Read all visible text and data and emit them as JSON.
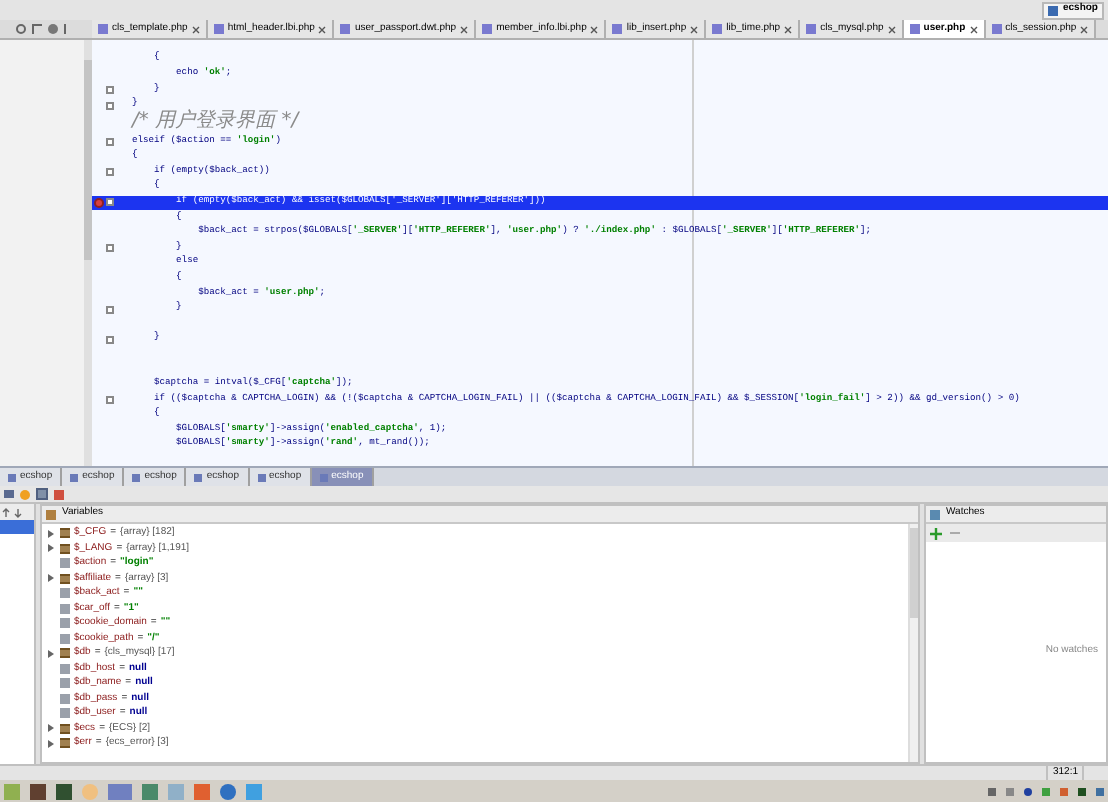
{
  "window_tab": {
    "label": "ecshop"
  },
  "file_tabs": [
    {
      "label": "cls_template.php",
      "selected": false
    },
    {
      "label": "html_header.lbi.php",
      "selected": false
    },
    {
      "label": "user_passport.dwt.php",
      "selected": false
    },
    {
      "label": "member_info.lbi.php",
      "selected": false
    },
    {
      "label": "lib_insert.php",
      "selected": false
    },
    {
      "label": "lib_time.php",
      "selected": false
    },
    {
      "label": "cls_mysql.php",
      "selected": false
    },
    {
      "label": "user.php",
      "selected": true
    },
    {
      "label": "cls_session.php",
      "selected": false
    }
  ],
  "code_lines": [
    {
      "text": "    {",
      "fold": false,
      "current": false,
      "kind": "code"
    },
    {
      "text": "        echo 'ok';",
      "fold": false,
      "current": false,
      "kind": "code"
    },
    {
      "text": "    }",
      "fold": true,
      "current": false,
      "kind": "code"
    },
    {
      "text": "}",
      "fold": true,
      "current": false,
      "kind": "code"
    },
    {
      "text": "/* 用户登录界面 */",
      "fold": false,
      "current": false,
      "kind": "comment"
    },
    {
      "text": "elseif ($action == 'login')",
      "fold": true,
      "current": false,
      "kind": "code"
    },
    {
      "text": "{",
      "fold": false,
      "current": false,
      "kind": "code"
    },
    {
      "text": "    if (empty($back_act))",
      "fold": true,
      "current": false,
      "kind": "code"
    },
    {
      "text": "    {",
      "fold": false,
      "current": false,
      "kind": "code"
    },
    {
      "text": "        if (empty($back_act) && isset($GLOBALS['_SERVER']['HTTP_REFERER']))",
      "fold": true,
      "current": true,
      "kind": "code"
    },
    {
      "text": "        {",
      "fold": false,
      "current": false,
      "kind": "code"
    },
    {
      "text": "            $back_act = strpos($GLOBALS['_SERVER']['HTTP_REFERER'], 'user.php') ? './index.php' : $GLOBALS['_SERVER']['HTTP_REFERER'];",
      "fold": false,
      "current": false,
      "kind": "code"
    },
    {
      "text": "        }",
      "fold": true,
      "current": false,
      "kind": "code"
    },
    {
      "text": "        else",
      "fold": false,
      "current": false,
      "kind": "code"
    },
    {
      "text": "        {",
      "fold": false,
      "current": false,
      "kind": "code"
    },
    {
      "text": "            $back_act = 'user.php';",
      "fold": false,
      "current": false,
      "kind": "code"
    },
    {
      "text": "        }",
      "fold": true,
      "current": false,
      "kind": "code"
    },
    {
      "kind": "blank"
    },
    {
      "text": "    }",
      "fold": true,
      "current": false,
      "kind": "code"
    },
    {
      "kind": "blank"
    },
    {
      "kind": "blank"
    },
    {
      "text": "    $captcha = intval($_CFG['captcha']);",
      "fold": false,
      "current": false,
      "kind": "code"
    },
    {
      "text": "    if (($captcha & CAPTCHA_LOGIN) && (!($captcha & CAPTCHA_LOGIN_FAIL) || (($captcha & CAPTCHA_LOGIN_FAIL) && $_SESSION['login_fail'] > 2)) && gd_version() > 0)",
      "fold": true,
      "current": false,
      "kind": "code"
    },
    {
      "text": "    {",
      "fold": false,
      "current": false,
      "kind": "code"
    },
    {
      "text": "        $GLOBALS['smarty']->assign('enabled_captcha', 1);",
      "fold": false,
      "current": false,
      "kind": "code"
    },
    {
      "text": "        $GLOBALS['smarty']->assign('rand', mt_rand());",
      "fold": false,
      "current": false,
      "kind": "code"
    }
  ],
  "debug_tabs": [
    {
      "label": "ecshop",
      "selected": false
    },
    {
      "label": "ecshop",
      "selected": false
    },
    {
      "label": "ecshop",
      "selected": false
    },
    {
      "label": "ecshop",
      "selected": false
    },
    {
      "label": "ecshop",
      "selected": false
    },
    {
      "label": "ecshop",
      "selected": true
    }
  ],
  "frames": [
    {
      "selected": true
    }
  ],
  "variables": {
    "title": "Variables",
    "items": [
      {
        "name": "$_CFG",
        "operator": "=",
        "value": "{array} [182]",
        "expandable": true,
        "kind": "object"
      },
      {
        "name": "$_LANG",
        "operator": "=",
        "value": "{array} [1,191]",
        "expandable": true,
        "kind": "object"
      },
      {
        "name": "$action",
        "operator": "=",
        "value": "\"login\"",
        "expandable": false,
        "kind": "string"
      },
      {
        "name": "$affiliate",
        "operator": "=",
        "value": "{array} [3]",
        "expandable": true,
        "kind": "object"
      },
      {
        "name": "$back_act",
        "operator": "=",
        "value": "\"\"",
        "expandable": false,
        "kind": "string"
      },
      {
        "name": "$car_off",
        "operator": "=",
        "value": "\"1\"",
        "expandable": false,
        "kind": "string"
      },
      {
        "name": "$cookie_domain",
        "operator": "=",
        "value": "\"\"",
        "expandable": false,
        "kind": "string"
      },
      {
        "name": "$cookie_path",
        "operator": "=",
        "value": "\"/\"",
        "expandable": false,
        "kind": "string"
      },
      {
        "name": "$db",
        "operator": "=",
        "value": "{cls_mysql} [17]",
        "expandable": true,
        "kind": "object"
      },
      {
        "name": "$db_host",
        "operator": "=",
        "value": "null",
        "expandable": false,
        "kind": "null"
      },
      {
        "name": "$db_name",
        "operator": "=",
        "value": "null",
        "expandable": false,
        "kind": "null"
      },
      {
        "name": "$db_pass",
        "operator": "=",
        "value": "null",
        "expandable": false,
        "kind": "null"
      },
      {
        "name": "$db_user",
        "operator": "=",
        "value": "null",
        "expandable": false,
        "kind": "null"
      },
      {
        "name": "$ecs",
        "operator": "=",
        "value": "{ECS} [2]",
        "expandable": true,
        "kind": "object"
      },
      {
        "name": "$err",
        "operator": "=",
        "value": "{ecs_error} [3]",
        "expandable": true,
        "kind": "object"
      }
    ]
  },
  "watches": {
    "title": "Watches",
    "empty_text": "No watches"
  },
  "status_bar": {
    "position": "312:1"
  }
}
